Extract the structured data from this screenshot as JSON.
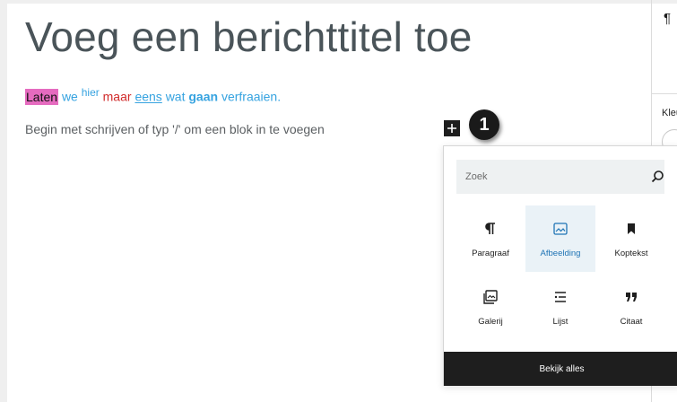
{
  "editor": {
    "title_placeholder": "Voeg een berichttitel toe",
    "paragraph": {
      "w1": "Laten",
      "w2": "we",
      "w3": "hier",
      "w4": "maar",
      "w5": "eens",
      "w6": "wat",
      "w7": "gaan",
      "w8": "verfraaien."
    },
    "block_placeholder": "Begin met schrijven of typ '/' om een blok in te voegen",
    "step_number": "1"
  },
  "sidebar": {
    "paragraph_symbol": "¶",
    "color_label": "Kleu"
  },
  "inserter": {
    "search_placeholder": "Zoek",
    "blocks": [
      {
        "label": "Paragraaf",
        "icon": "paragraph-icon"
      },
      {
        "label": "Afbeelding",
        "icon": "image-icon",
        "selected": true
      },
      {
        "label": "Koptekst",
        "icon": "bookmark-icon"
      },
      {
        "label": "Galerij",
        "icon": "gallery-icon"
      },
      {
        "label": "Lijst",
        "icon": "list-icon"
      },
      {
        "label": "Citaat",
        "icon": "quote-icon"
      }
    ],
    "view_all_label": "Bekijk alles"
  },
  "colors": {
    "highlight": "#e56bbf",
    "link_blue": "#36a3e0",
    "red": "#d12b2b",
    "selected_bg": "#eaf2f7",
    "dark": "#1e1e1e"
  }
}
